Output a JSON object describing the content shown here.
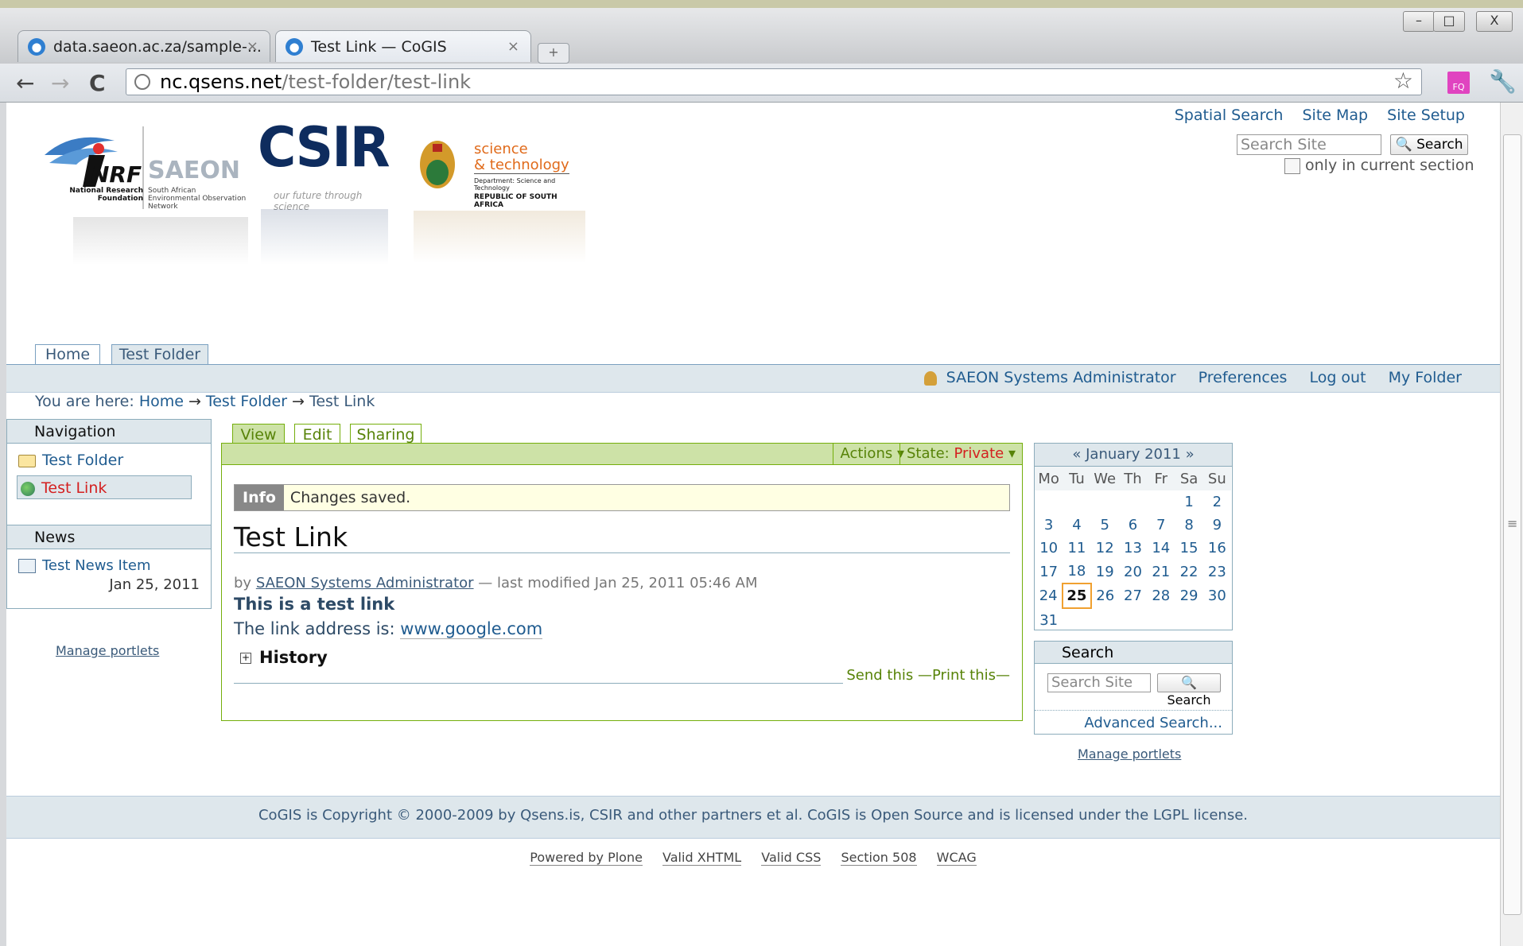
{
  "browser": {
    "tabs": [
      {
        "label": "data.saeon.ac.za/sample-...",
        "close": "×"
      },
      {
        "label": "Test Link — CoGIS",
        "close": "×"
      }
    ],
    "new_tab": "+",
    "window_buttons": {
      "minimize": "–",
      "maximize": "□",
      "close": "X"
    },
    "nav": {
      "back": "←",
      "forward": "→",
      "reload": "C"
    },
    "address": {
      "host": "nc.qsens.net",
      "path": "/test-folder/test-link"
    },
    "star": "☆",
    "fq": "FQ",
    "wrench": "🔧"
  },
  "site_actions": [
    "Spatial Search",
    "Site Map",
    "Site Setup"
  ],
  "search": {
    "placeholder": "Search Site",
    "button": "Search",
    "only_section": "only in current section"
  },
  "logos": {
    "nrf": "NRF",
    "nrf_sub": "National Research Foundation",
    "saeon": "SAEON",
    "saeon_sub": "South African Environmental Observation Network",
    "csir": "CSIR",
    "csir_sub": "our future through science",
    "dst_1": "science",
    "dst_2": "& technology",
    "dst_3": "Department: Science and Technology",
    "dst_4": "REPUBLIC OF SOUTH AFRICA"
  },
  "global_tabs": [
    "Home",
    "Test Folder"
  ],
  "personal_bar": {
    "user": "SAEON Systems Administrator",
    "items": [
      "Preferences",
      "Log out",
      "My Folder"
    ]
  },
  "breadcrumb": {
    "prefix": "You are here:",
    "sep": "→",
    "items": [
      "Home",
      "Test Folder",
      "Test Link"
    ]
  },
  "navigation_portlet": {
    "title": "Navigation",
    "items": [
      "Test Folder",
      "Test Link"
    ]
  },
  "news_portlet": {
    "title": "News",
    "item": "Test News Item",
    "date": "Jan 25, 2011"
  },
  "manage_portlets": "Manage portlets",
  "content_tabs": [
    "View",
    "Edit",
    "Sharing"
  ],
  "content_actions": {
    "actions": "Actions ▾",
    "state_label": "State:",
    "state_value": "Private",
    "state_arrow": "▾"
  },
  "status_message": {
    "label": "Info",
    "text": "Changes saved."
  },
  "content": {
    "title": "Test Link",
    "by": "by",
    "author": "SAEON Systems Administrator",
    "modified": "— last modified Jan 25, 2011 05:46 AM",
    "description": "This is a test link",
    "link_prefix": "The link address is:",
    "link_url": "www.google.com",
    "history": "History",
    "send_this": "Send this",
    "print_this": "Print this",
    "sep": "—"
  },
  "calendar": {
    "header": "« January 2011 »",
    "weekdays": [
      "Mo",
      "Tu",
      "We",
      "Th",
      "Fr",
      "Sa",
      "Su"
    ],
    "weeks": [
      [
        "",
        "",
        "",
        "",
        "",
        "1",
        "2"
      ],
      [
        "3",
        "4",
        "5",
        "6",
        "7",
        "8",
        "9"
      ],
      [
        "10",
        "11",
        "12",
        "13",
        "14",
        "15",
        "16"
      ],
      [
        "17",
        "18",
        "19",
        "20",
        "21",
        "22",
        "23"
      ],
      [
        "24",
        "25",
        "26",
        "27",
        "28",
        "29",
        "30"
      ],
      [
        "31",
        "",
        "",
        "",
        "",
        "",
        ""
      ]
    ],
    "today": "25"
  },
  "search_portlet": {
    "title": "Search",
    "placeholder": "Search Site",
    "button": "Search",
    "advanced": "Advanced Search..."
  },
  "footer": "CoGIS is Copyright © 2000-2009 by Qsens.is, CSIR and other partners et al. CoGIS is Open Source and is licensed under the LGPL license.",
  "colophon": [
    "Powered by Plone",
    "Valid XHTML",
    "Valid CSS",
    "Section 508",
    "WCAG"
  ]
}
